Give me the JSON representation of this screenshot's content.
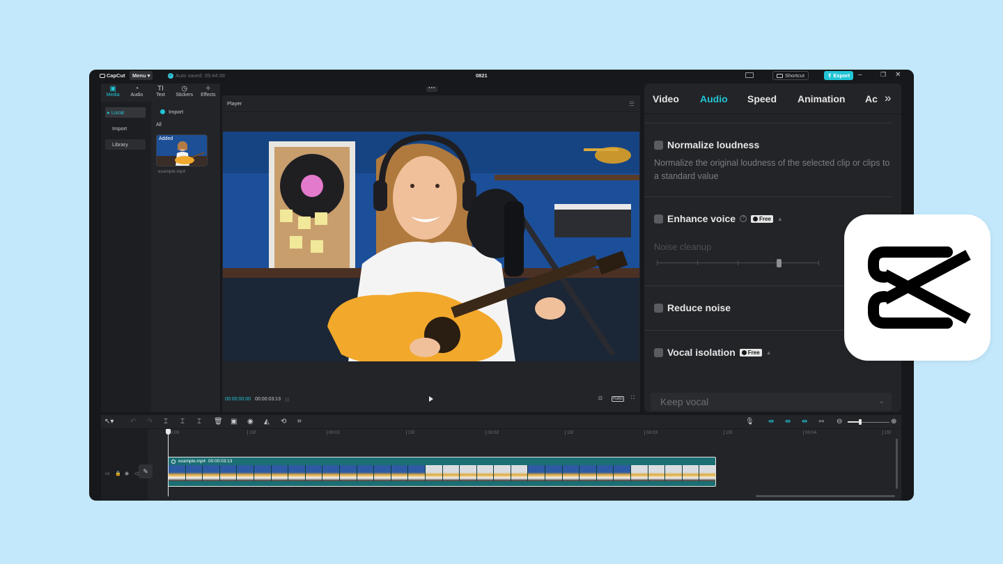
{
  "titlebar": {
    "app_name": "CapCut",
    "menu_label": "Menu",
    "autosave": "Auto saved: 09:44:38",
    "project_name": "0821",
    "shortcut_label": "Shortcut",
    "export_label": "Export"
  },
  "left_panel": {
    "tabs": [
      {
        "label": "Media",
        "icon": "media-icon"
      },
      {
        "label": "Audio",
        "icon": "audio-icon"
      },
      {
        "label": "Text",
        "icon": "text-icon"
      },
      {
        "label": "Stickers",
        "icon": "stickers-icon"
      },
      {
        "label": "Effects",
        "icon": "effects-icon"
      }
    ],
    "sidebar": [
      "Local",
      "Import",
      "Library"
    ],
    "import_label": "Import",
    "all_label": "All",
    "media_item": {
      "badge": "Added",
      "filename": "example.mp4"
    }
  },
  "player": {
    "title": "Player",
    "current_time": "00:00:00:00",
    "duration": "00:00:03:13",
    "ratio_label": "Ratio"
  },
  "right_panel": {
    "tabs": [
      "Video",
      "Audio",
      "Speed",
      "Animation",
      "Ac"
    ],
    "active_tab": "Audio",
    "normalize": {
      "label": "Normalize loudness",
      "description": "Normalize the original loudness of the selected clip or clips to a standard value"
    },
    "enhance_voice": {
      "label": "Enhance voice",
      "badge": "Free"
    },
    "noise_cleanup": {
      "label": "Noise cleanup",
      "level": 0.8
    },
    "reduce_noise": {
      "label": "Reduce noise"
    },
    "vocal_isolation": {
      "label": "Vocal isolation",
      "badge": "Free"
    },
    "keep_vocal": "Keep vocal"
  },
  "timeline": {
    "ruler": [
      "00:00",
      "15f",
      "00:01",
      "15f",
      "00:02",
      "15f",
      "00:03",
      "15f",
      "00:04",
      "15f"
    ],
    "clip": {
      "name": "example.mp4",
      "duration": "00:00:03:13"
    }
  },
  "colors": {
    "accent": "#22c5d6",
    "background": "#c3e8fc",
    "app_bg": "#17181b",
    "panel_bg": "#232428"
  }
}
